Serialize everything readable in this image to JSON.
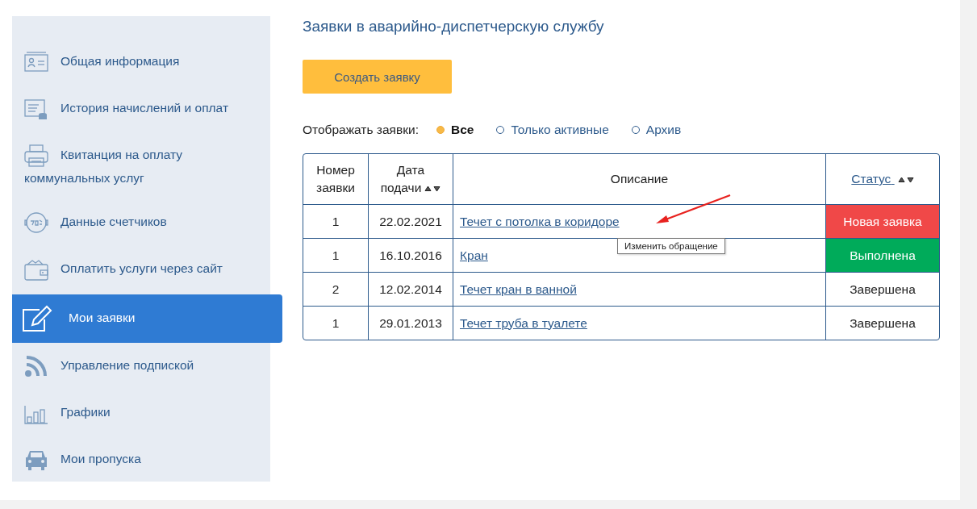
{
  "sidebar": {
    "items": [
      {
        "kind": "id-card",
        "label": "Общая информация",
        "selected": false
      },
      {
        "kind": "history",
        "label": "История начислений и оплат",
        "selected": false
      },
      {
        "kind": "printer",
        "label": "Квитанция на оплату коммунальных услуг",
        "selected": false
      },
      {
        "kind": "meter",
        "label": "Данные счетчиков",
        "selected": false
      },
      {
        "kind": "wallet",
        "label": "Оплатить услуги через сайт",
        "selected": false
      },
      {
        "kind": "edit",
        "label": "Мои заявки",
        "selected": true
      },
      {
        "kind": "rss",
        "label": "Управление подпиской",
        "selected": false
      },
      {
        "kind": "chart",
        "label": "Графики",
        "selected": false
      },
      {
        "kind": "car",
        "label": "Мои пропуска",
        "selected": false
      }
    ]
  },
  "page_title": "Заявки в аварийно-диспетчерскую службу",
  "create_button": "Создать заявку",
  "filter": {
    "label": "Отображать заявки:",
    "options": [
      {
        "label": "Все",
        "selected": true
      },
      {
        "label": "Только активные",
        "selected": false
      },
      {
        "label": "Архив",
        "selected": false
      }
    ]
  },
  "table": {
    "columns": [
      {
        "label": "Номер заявки",
        "kind": "plain"
      },
      {
        "label": "Дата подачи",
        "kind": "sortable"
      },
      {
        "label": "Описание",
        "kind": "plain"
      },
      {
        "label": "Статус",
        "kind": "sortable-link"
      }
    ],
    "rows": [
      {
        "number": "1",
        "date": "22.02.2021",
        "description": "Течет с потолка в коридоре",
        "status": {
          "text": "Новая заявка",
          "kind": "new"
        }
      },
      {
        "number": "1",
        "date": "16.10.2016",
        "description": "Кран",
        "status": {
          "text": "Выполнена",
          "kind": "done"
        }
      },
      {
        "number": "2",
        "date": "12.02.2014",
        "description": "Течет кран в ванной",
        "status": {
          "text": "Завершена",
          "kind": "closed"
        }
      },
      {
        "number": "1",
        "date": "29.01.2013",
        "description": "Течет труба в туалете",
        "status": {
          "text": "Завершена",
          "kind": "closed"
        }
      }
    ]
  },
  "tooltip": "Изменить обращение"
}
